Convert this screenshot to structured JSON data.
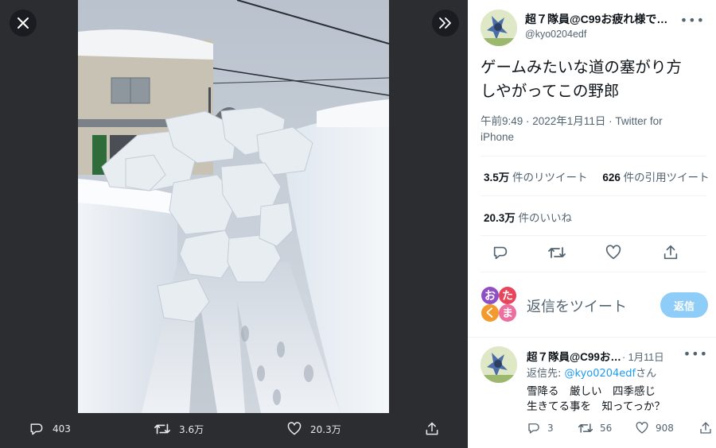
{
  "viewer": {
    "actions": {
      "reply_count": "403",
      "retweet_count": "3.6万",
      "like_count": "20.3万"
    }
  },
  "tweet": {
    "author_name": "超７隊員@C99お疲れ様で…",
    "author_handle": "@kyo0204edf",
    "text_line1": "ゲームみたいな道の塞がり方",
    "text_line2": "しやがってこの野郎",
    "time": "午前9:49 · 2022年1月11日 · ",
    "source_line1": "Twitter for",
    "source_line2": "iPhone",
    "retweets_num": "3.5万",
    "retweets_label": "件のリツイート",
    "quotes_num": "626",
    "quotes_label": "件の引用ツイート",
    "likes_num": "20.3万",
    "likes_label": "件のいいね"
  },
  "reply_composer": {
    "logo_text": [
      "お",
      "た",
      "く",
      "ま"
    ],
    "placeholder": "返信をツイート",
    "button": "返信"
  },
  "reply": {
    "author_name": "超７隊員@C99お…",
    "date": "· 1月11日",
    "reply_to_prefix": "返信先: ",
    "reply_to_mention": "@kyo0204edf",
    "reply_to_suffix": "さん",
    "line1": "雪降る　厳しい　四季感じ",
    "line2": "生きてる事を　知ってっか？",
    "reply_count": "3",
    "retweet_count": "56",
    "like_count": "908"
  },
  "colors": {
    "accent": "#1d9bf0",
    "viewer_bg": "#2b2d31",
    "reply_button": "#8ecdf7"
  }
}
